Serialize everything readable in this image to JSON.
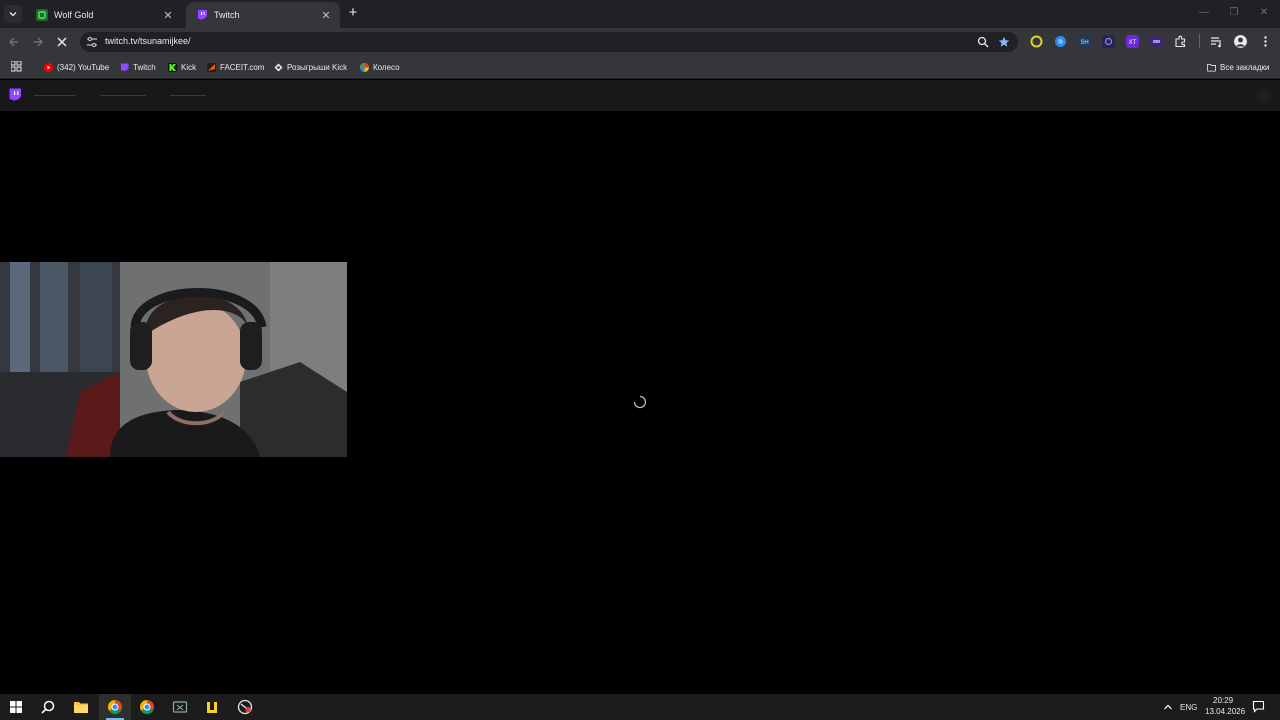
{
  "browser": {
    "tabs": [
      {
        "title": "Wolf Gold",
        "active": false,
        "favicon": "wolf-gold-favicon"
      },
      {
        "title": "Twitch",
        "active": true,
        "favicon": "twitch-favicon"
      }
    ],
    "address": {
      "url": "twitch.tv/tsunamijkee/"
    },
    "bookmarks": [
      {
        "label": "(342) YouTube",
        "icon": "youtube-icon"
      },
      {
        "label": "Twitch",
        "icon": "twitch-icon"
      },
      {
        "label": "Kick",
        "icon": "kick-icon"
      },
      {
        "label": "FACEIT.com",
        "icon": "faceit-icon"
      },
      {
        "label": "Розыгрыши Kick",
        "icon": "giveaway-icon"
      },
      {
        "label": "Колесо",
        "icon": "wheel-icon"
      }
    ],
    "all_bookmarks_label": "Все закладки"
  },
  "page": {
    "state": "loading"
  },
  "taskbar": {
    "language": "ENG",
    "time": "20:29",
    "date": "13.04.2026"
  },
  "colors": {
    "tabstrip": "#202124",
    "toolbar": "#35363a",
    "twitch_purple": "#9146ff",
    "page_background": "#000000"
  }
}
